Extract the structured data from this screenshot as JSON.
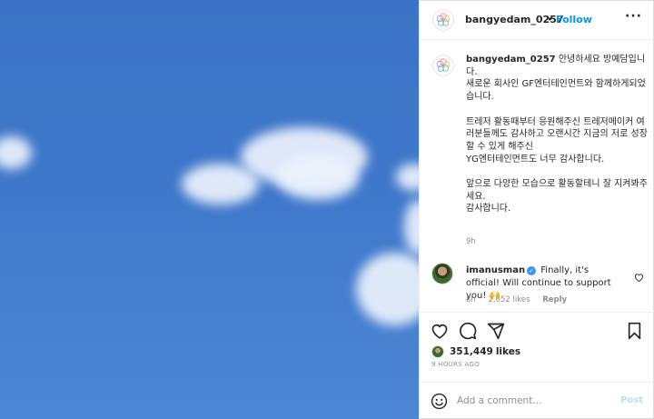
{
  "header": {
    "username": "bangyedam_0257",
    "separator": "•",
    "follow_label": "Follow",
    "more_label": "···"
  },
  "caption": {
    "username": "bangyedam_0257",
    "text": "안녕하세요 방예담입니다.\n새로운 회사인 GF엔터테인먼트와 함께하게되었습니다.\n\n트레저 활동때부터 응원해주신 트레저메이커 여러분들께도 감사하고 오랜시간 지금의 저로 성장할 수 있게 해주신\nYG엔터테인먼트도 너무 감사합니다.\n\n앞으로 다양한 모습으로 활동할테니 잘 지켜봐주세요.\n감사합니다.",
    "time": "9h"
  },
  "comment": {
    "username": "imanusman",
    "verified_mark": "✓",
    "text": "Finally, it's official! Will continue to support you! 🙌",
    "time": "8h",
    "likes": "2,052 likes",
    "reply_label": "Reply"
  },
  "post": {
    "likes_count": "351,449",
    "likes_word": "likes",
    "ago": "9 HOURS AGO"
  },
  "add_comment": {
    "placeholder": "Add a comment…",
    "post_label": "Post"
  },
  "icons": {
    "heart": "heart-icon",
    "comment": "comment-icon",
    "share": "share-icon",
    "save": "bookmark-icon",
    "emoji": "emoji-icon"
  },
  "colors": {
    "accent": "#0095f6",
    "verified": "#3897f0",
    "sky": "#3f78ca"
  }
}
